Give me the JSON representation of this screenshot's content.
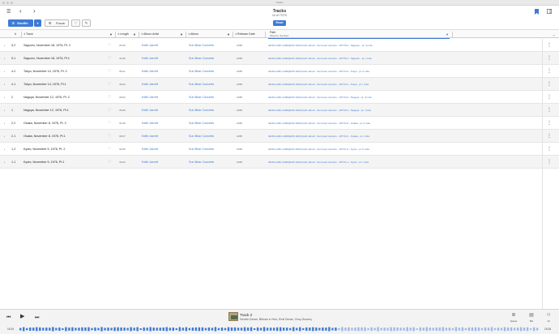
{
  "window": {
    "title": "Tracks"
  },
  "toolbar": {
    "menu_icon": "list-icon",
    "back_icon": "chevron-left-icon",
    "forward_icon": "chevron-right-icon",
    "nav_title": "Tracks",
    "nav_subtitle": "10 of 77270",
    "reset_label": "Reset",
    "bookmark_icon": "bookmark-icon",
    "inspector_icon": "sidebar-icon",
    "shuffle_label": "Shuffle",
    "focus_label": "Focus",
    "heart_icon": "heart-icon",
    "tag_icon": "tag-icon"
  },
  "columns": {
    "number": "#",
    "track": "Track",
    "length": "Length",
    "album_artist": "Album Artist",
    "album": "Album",
    "release_date": "Release Date",
    "path": "Path",
    "path_filter": "Filtered by \"Sun Bear\""
  },
  "rows": [
    {
      "num": "5-2",
      "track": "Sapporo, November 18, 1976, Pt. 2",
      "length": "33:30",
      "artist": "Keith Jarrett",
      "album": "Sun Bear Concerts",
      "year": "1978",
      "path": "/ECM/+1001-1100/[ECM 1100] Keith Jarrett - Sun bear concerts - 1977/5-2 - Sapporo - pt. II.m4a"
    },
    {
      "num": "5-1",
      "track": "Sapporo, November 18, 1976, Pt.1",
      "length": "41:05",
      "artist": "Keith Jarrett",
      "album": "Sun Bear Concerts",
      "year": "1978",
      "path": "/ECM/+1001-1100/[ECM 1100] Keith Jarrett - Sun bear concerts - 1977/5-1 - Sapporo - pt. I.m4a"
    },
    {
      "num": "4-2",
      "track": "Tokyo, November 14, 1976, Pt. 2",
      "length": "35:21",
      "artist": "Keith Jarrett",
      "album": "Sun Bear Concerts",
      "year": "1978",
      "path": "/ECM/+1001-1100/[ECM 1100] Keith Jarrett - Sun bear concerts - 1977/4-2 - Tokyo - pt. II.m4a"
    },
    {
      "num": "4-1",
      "track": "Tokyo, November 14, 1976, Pt.1",
      "length": "40:22",
      "artist": "Keith Jarrett",
      "album": "Sun Bear Concerts",
      "year": "1978",
      "path": "/ECM/+1001-1100/[ECM 1100] Keith Jarrett - Sun bear concerts - 1977/4-1 - Tokyo - pt. I.m4a"
    },
    {
      "num": "2",
      "track": "Nagoya, November 12, 1976, Pt. 2",
      "length": "39:02",
      "artist": "Keith Jarrett",
      "album": "Sun Bear Concerts",
      "year": "1978",
      "path": "/ECM/+1001-1100/[ECM 1100] Keith Jarrett - Sun bear concerts - 1977/3-2 - Nagoya - pt. II.m4a"
    },
    {
      "num": "1",
      "track": "Nagoya, November 12, 1976, Pt.1",
      "length": "35:36",
      "artist": "Keith Jarrett",
      "album": "Sun Bear Concerts",
      "year": "1978",
      "path": "/ECM/+1001-1100/[ECM 1100] Keith Jarrett - Sun bear concerts - 1977/3-1 - Nagoya - pt. I.m4a"
    },
    {
      "num": "2-2",
      "track": "Osaka, November 8, 1976, Pt. 2",
      "length": "31:09",
      "artist": "Keith Jarrett",
      "album": "Sun Bear Concerts",
      "year": "1978",
      "path": "/ECM/+1001-1100/[ECM 1100] Keith Jarrett - Sun bear concerts - 1977/2-2 - Osaka - pt. II.m4a"
    },
    {
      "num": "2-1",
      "track": "Osaka, November 8, 1976, Pt.1",
      "length": "36:07",
      "artist": "Keith Jarrett",
      "album": "Sun Bear Concerts",
      "year": "1978",
      "path": "/ECM/+1001-1100/[ECM 1100] Keith Jarrett - Sun bear concerts - 1977/2-1 - Osaka - pt. I.m4a"
    },
    {
      "num": "1-2",
      "track": "Kyoto, November 5, 1976, Pt. 2",
      "length": "34:05",
      "artist": "Keith Jarrett",
      "album": "Sun Bear Concerts",
      "year": "1978",
      "path": "/ECM/+1001-1100/[ECM 1100] Keith Jarrett - Sun bear concerts - 1977/1-2 - Kyoto - pt. II.m4a"
    },
    {
      "num": "1-1",
      "track": "Kyoto, November 5, 1976, Pt.1",
      "length": "43:04",
      "artist": "Keith Jarrett",
      "album": "Sun Bear Concerts",
      "year": "1978",
      "path": "/ECM/+1001-1100/[ECM 1100] Keith Jarrett - Sun bear concerts - 1977/1-1 - Kyoto - pt. I.m4a"
    }
  ],
  "player": {
    "title": "Track 2",
    "artist": "Sevdin Deran, Bülvan a Yten, Emil Deran, Oruç Guvenç",
    "elapsed": "15:15",
    "remaining": "15:28",
    "queue_label": "Queue",
    "mix_label": "Mix",
    "count_label": "14",
    "progress": 0.61
  },
  "colors": {
    "accent": "#3d7ad6"
  }
}
